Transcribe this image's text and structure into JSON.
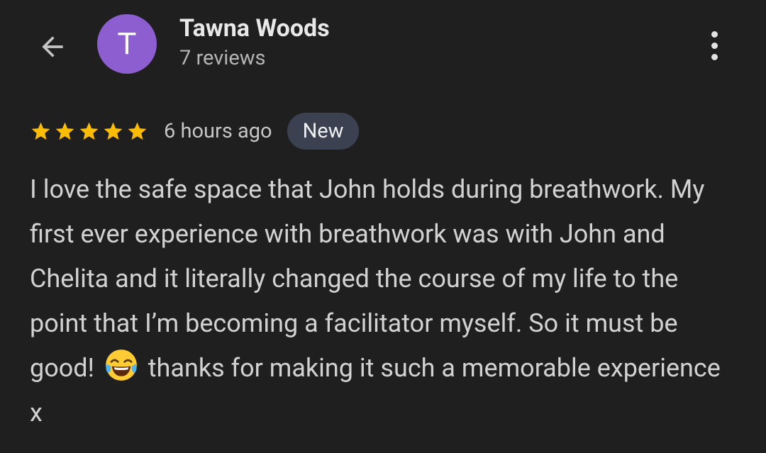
{
  "colors": {
    "background": "#1f1f1f",
    "avatar": "#8c5ed0",
    "star": "#fbbc04",
    "badge_bg": "#3b4150"
  },
  "header": {
    "back_icon": "arrow-left-icon",
    "avatar_letter": "T",
    "name": "Tawna Woods",
    "reviews": "7 reviews",
    "more_icon": "more-vertical-icon"
  },
  "review": {
    "rating": 5,
    "timestamp": "6 hours ago",
    "badge": "New",
    "text_before_emoji": "I love the safe space that John holds during breathwork. My first ever experience with breathwork was with John and Chelita and it literally changed the course of my life to the point that I’m becoming a facilitator myself. So it must be good!",
    "emoji": "face-with-tears-of-joy-emoji",
    "text_after_emoji": "thanks for making it such a memorable experience x"
  }
}
